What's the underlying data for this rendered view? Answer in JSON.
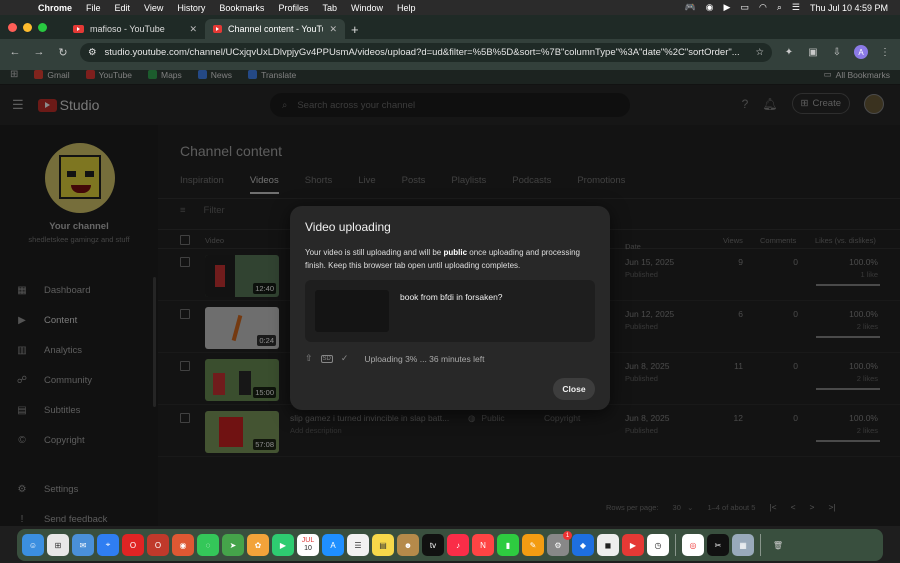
{
  "menubar": {
    "app": "Chrome",
    "items": [
      "File",
      "Edit",
      "View",
      "History",
      "Bookmarks",
      "Profiles",
      "Tab",
      "Window",
      "Help"
    ],
    "datetime": "Thu Jul 10  4:59 PM"
  },
  "browser": {
    "tabs": [
      {
        "title": "mafioso - YouTube"
      },
      {
        "title": "Channel content - YouTube S"
      }
    ],
    "url": "studio.youtube.com/channel/UCxjqvUxLDlvpjyGv4PPUsmA/videos/upload?d=ud&filter=%5B%5D&sort=%7B\"columnType\"%3A\"date\"%2C\"sortOrder\"...",
    "profile_initial": "A",
    "bookmarks": [
      {
        "label": "Gmail",
        "color": "#ea4335"
      },
      {
        "label": "YouTube",
        "color": "#e53935"
      },
      {
        "label": "Maps",
        "color": "#34a853"
      },
      {
        "label": "News",
        "color": "#4285f4"
      },
      {
        "label": "Translate",
        "color": "#4285f4"
      }
    ],
    "all_bookmarks": "All Bookmarks"
  },
  "studio": {
    "logo": "Studio",
    "search_placeholder": "Search across your channel",
    "create_label": "Create",
    "channel": {
      "title": "Your channel",
      "subtitle": "shedletskee gamingz and stuff"
    },
    "nav": [
      {
        "label": "Dashboard",
        "icon": "dashboard-icon"
      },
      {
        "label": "Content",
        "icon": "content-icon"
      },
      {
        "label": "Analytics",
        "icon": "analytics-icon"
      },
      {
        "label": "Community",
        "icon": "community-icon"
      },
      {
        "label": "Subtitles",
        "icon": "subtitles-icon"
      },
      {
        "label": "Copyright",
        "icon": "copyright-icon"
      }
    ],
    "nav_bottom": [
      {
        "label": "Settings",
        "icon": "gear-icon"
      },
      {
        "label": "Send feedback",
        "icon": "feedback-icon"
      }
    ],
    "page_title": "Channel content",
    "tabs": [
      "Inspiration",
      "Videos",
      "Shorts",
      "Live",
      "Posts",
      "Playlists",
      "Podcasts",
      "Promotions"
    ],
    "filter_placeholder": "Filter",
    "columns": {
      "video": "Video",
      "date": "Date",
      "views": "Views",
      "comments": "Comments",
      "likes": "Likes (vs. dislikes)"
    },
    "rows": [
      {
        "duration": "12:40",
        "date": "Jun 15, 2025",
        "status": "Published",
        "views": "9",
        "comments": "0",
        "likes": "100.0%",
        "likes_sub": "1 like",
        "title": "",
        "visibility": "",
        "restrictions": "",
        "description": ""
      },
      {
        "duration": "0:24",
        "date": "Jun 12, 2025",
        "status": "Published",
        "views": "6",
        "comments": "0",
        "likes": "100.0%",
        "likes_sub": "2 likes",
        "title": "",
        "visibility": "",
        "restrictions": "",
        "description": ""
      },
      {
        "duration": "15:00",
        "date": "Jun 8, 2025",
        "status": "Published",
        "views": "11",
        "comments": "0",
        "likes": "100.0%",
        "likes_sub": "2 likes",
        "title": "",
        "visibility": "",
        "restrictions": "",
        "description": ""
      },
      {
        "duration": "57:08",
        "date": "Jun 8, 2025",
        "status": "Published",
        "views": "12",
        "comments": "0",
        "likes": "100.0%",
        "likes_sub": "2 likes",
        "title": "slip gamez i turned invincible in slap batt...",
        "visibility": "Public",
        "restrictions": "Copyright",
        "description": "Add description"
      }
    ],
    "pager": {
      "rows_label": "Rows per page:",
      "rows_value": "30",
      "range": "1–4 of about 5"
    }
  },
  "modal": {
    "title": "Video uploading",
    "text_before": "Your video is still uploading and will be ",
    "text_bold": "public",
    "text_after": " once uploading and processing finish. Keep this browser tab open until uploading completes.",
    "video_title": "book from bfdi in forsaken?",
    "sd_label": "SD",
    "status": "Uploading 3% ... 36 minutes left",
    "progress": 0.03,
    "close_label": "Close"
  },
  "dock": {
    "calendar_month": "JUL",
    "calendar_day": "10",
    "badge": "1"
  }
}
